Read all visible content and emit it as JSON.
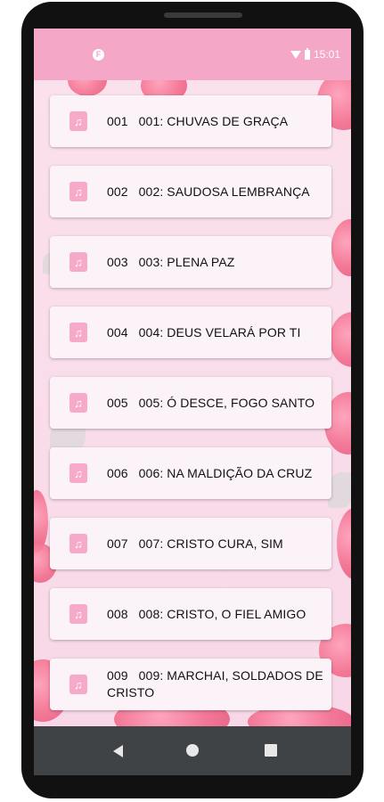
{
  "status": {
    "left_icon": "F",
    "time": "15:01",
    "icons": [
      "app-badge-icon",
      "wifi-icon",
      "battery-icon"
    ]
  },
  "colors": {
    "statusbar": "#f4a7c6",
    "icon": "#f6a9c8",
    "card": "#fbf3f7",
    "navbar": "#3f4346"
  },
  "songs": [
    {
      "num": "001",
      "title": "001: CHUVAS DE GRAÇA"
    },
    {
      "num": "002",
      "title": "002: SAUDOSA LEMBRANÇA"
    },
    {
      "num": "003",
      "title": "003: PLENA PAZ"
    },
    {
      "num": "004",
      "title": "004: DEUS VELARÁ POR TI"
    },
    {
      "num": "005",
      "title": "005: Ó DESCE, FOGO SANTO"
    },
    {
      "num": "006",
      "title": "006: NA MALDIÇÃO DA CRUZ"
    },
    {
      "num": "007",
      "title": "007: CRISTO CURA, SIM"
    },
    {
      "num": "008",
      "title": "008: CRISTO, O FIEL AMIGO"
    },
    {
      "num": "009",
      "title": "009: MARCHAI, SOLDADOS DE CRISTO"
    }
  ],
  "nav": {
    "icons": [
      "back-icon",
      "home-icon",
      "recents-icon"
    ]
  }
}
